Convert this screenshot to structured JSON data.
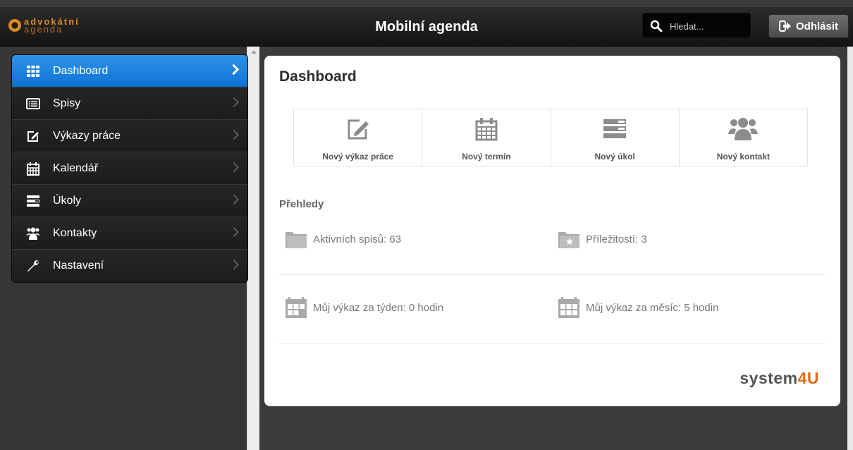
{
  "header": {
    "logo_line1": "advokátní",
    "logo_line2": "agenda",
    "title": "Mobilní agenda",
    "search_placeholder": "Hledat...",
    "logout_label": "Odhlásit"
  },
  "sidebar": {
    "items": [
      {
        "label": "Dashboard",
        "icon": "grid-icon",
        "active": true
      },
      {
        "label": "Spisy",
        "icon": "list-icon",
        "active": false
      },
      {
        "label": "Výkazy práce",
        "icon": "edit-icon",
        "active": false
      },
      {
        "label": "Kalendář",
        "icon": "calendar-icon",
        "active": false
      },
      {
        "label": "Úkoly",
        "icon": "tasks-icon",
        "active": false
      },
      {
        "label": "Kontakty",
        "icon": "users-icon",
        "active": false
      },
      {
        "label": "Nastavení",
        "icon": "wrench-icon",
        "active": false
      }
    ]
  },
  "main": {
    "title": "Dashboard",
    "quick_actions": [
      {
        "label": "Nový výkaz práce",
        "icon": "edit-icon"
      },
      {
        "label": "Nový termín",
        "icon": "calendar-icon"
      },
      {
        "label": "Nový úkol",
        "icon": "tasks-icon"
      },
      {
        "label": "Nový kontakt",
        "icon": "users-icon"
      }
    ],
    "overview_title": "Přehledy",
    "stats": {
      "active_files": "Aktivních spisů: 63",
      "opportunities": "Příležitostí: 3",
      "week_report": "Můj výkaz za týden: 0 hodin",
      "month_report": "Můj výkaz za měsíc: 5 hodin"
    },
    "brand_part1": "system",
    "brand_part2": "4U"
  },
  "colors": {
    "accent": "#1a80dd",
    "brand_orange": "#e46b1b",
    "logo_orange": "#d98b26"
  }
}
